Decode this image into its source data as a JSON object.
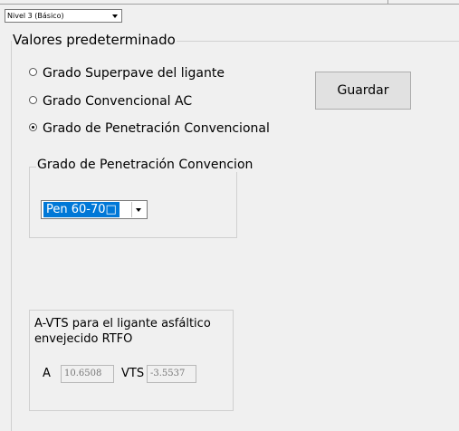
{
  "level_select": {
    "value": "Nivel 3 (Básico)"
  },
  "defaults_group": {
    "legend": "Valores predeterminado",
    "options": [
      {
        "label": "Grado Superpave del ligante",
        "selected": false
      },
      {
        "label": "Grado Convencional AC",
        "selected": false
      },
      {
        "label": "Grado de Penetración Convencional",
        "selected": true
      }
    ],
    "save_label": "Guardar"
  },
  "penetration_group": {
    "legend": "Grado de Penetración Convencion",
    "selected_value": "Pen 60-70□"
  },
  "avts_group": {
    "title": "A-VTS para el ligante asfáltico envejecido RTFO",
    "a_label": "A",
    "a_value": "10.6508",
    "vts_label": "VTS",
    "vts_value": "-3.5537"
  },
  "colors": {
    "highlight": "#0078d7",
    "background": "#f0f0f0"
  }
}
